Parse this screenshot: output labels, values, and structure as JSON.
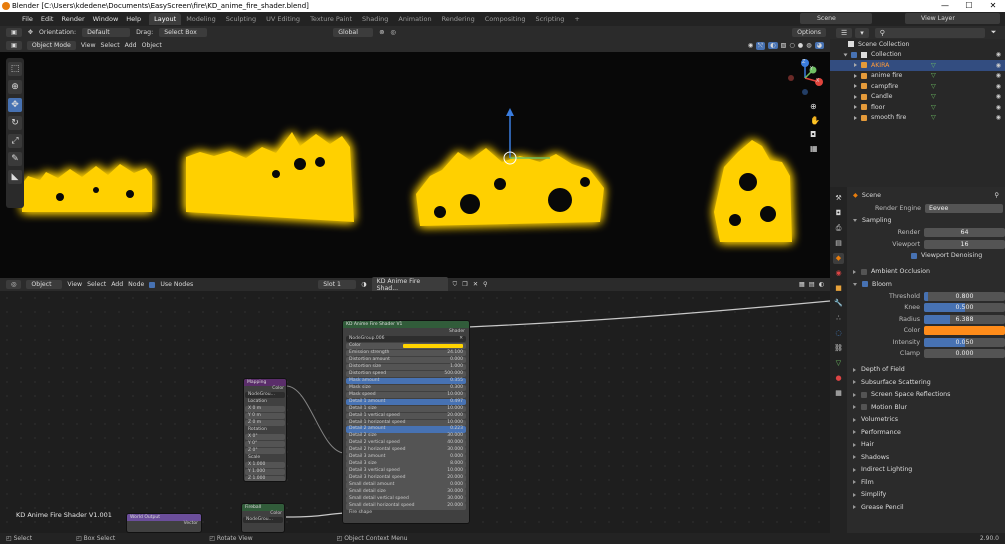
{
  "window": {
    "title": "Blender [C:\\Users\\kdedene\\Documents\\EasyScreen\\fire\\KD_anime_fire_shader.blend]",
    "minimize": "—",
    "maximize": "☐",
    "close": "✕"
  },
  "menu": [
    "File",
    "Edit",
    "Render",
    "Window",
    "Help"
  ],
  "workspaces": [
    "Layout",
    "Modeling",
    "Sculpting",
    "UV Editing",
    "Texture Paint",
    "Shading",
    "Animation",
    "Rendering",
    "Compositing",
    "Scripting"
  ],
  "scene": "Scene",
  "view_layer": "View Layer",
  "tool_header": {
    "orientation_label": "Orientation:",
    "orientation": "Default",
    "drag_label": "Drag:",
    "drag": "Select Box",
    "transform": "Global",
    "options": "Options"
  },
  "viewport_header": {
    "mode": "Object Mode",
    "menus": [
      "View",
      "Select",
      "Add",
      "Object"
    ]
  },
  "gizmo": {
    "x": "X",
    "y": "Y",
    "z": "Z"
  },
  "node_header": {
    "editor_type": "Object",
    "menus": [
      "View",
      "Select",
      "Add",
      "Node"
    ],
    "use_nodes": "Use Nodes",
    "slot": "Slot 1",
    "material": "KD Anime Fire Shad..."
  },
  "node_label": "KD Anime Fire Shader V1.001",
  "nodes": {
    "main_title": "KD Anime Fire Shader V1",
    "main_output": "Shader",
    "group_name": "NodeGroup.006",
    "main_rows": [
      {
        "label": "Emission strength",
        "value": "24.100"
      },
      {
        "label": "Distortion amount",
        "value": "0.000"
      },
      {
        "label": "Distortion size",
        "value": "1.000"
      },
      {
        "label": "Distortion speed",
        "value": "500.000"
      },
      {
        "label": "Mask amount",
        "value": "0.355"
      },
      {
        "label": "Mask size",
        "value": "0.300"
      },
      {
        "label": "Mask speed",
        "value": "10.000"
      },
      {
        "label": "Detail 1 amount",
        "value": "0.497"
      },
      {
        "label": "Detail 1 size",
        "value": "10.000"
      },
      {
        "label": "Detail 1 vertical speed",
        "value": "20.000"
      },
      {
        "label": "Detail 1 horizontal speed",
        "value": "10.000"
      },
      {
        "label": "Detail 2 amount",
        "value": "0.223"
      },
      {
        "label": "Detail 2 size",
        "value": "30.000"
      },
      {
        "label": "Detail 2 vertical speed",
        "value": "40.000"
      },
      {
        "label": "Detail 2 horizontal speed",
        "value": "30.000"
      },
      {
        "label": "Detail 3 amount",
        "value": "0.000"
      },
      {
        "label": "Detail 3 size",
        "value": "8.000"
      },
      {
        "label": "Detail 3 vertical speed",
        "value": "10.000"
      },
      {
        "label": "Detail 3 horizontal speed",
        "value": "20.000"
      },
      {
        "label": "Small detail amount",
        "value": "0.000"
      },
      {
        "label": "Small detail size",
        "value": "30.000"
      },
      {
        "label": "Small detail vertical speed",
        "value": "30.000"
      },
      {
        "label": "Small detail horizontal speed",
        "value": "20.000"
      },
      {
        "label": "Fire shape",
        "value": ""
      }
    ],
    "color_label": "Color",
    "mapping_title": "Mapping",
    "mapping_group": "NodeGrou...",
    "mapping_rows": [
      "Location",
      "X  0 m",
      "Y  0 m",
      "Z  0 m",
      "Rotation",
      "X  0°",
      "Y  0°",
      "Z  0°",
      "Scale",
      "X  1.000",
      "Y  1.000",
      "Z  1.000"
    ],
    "mapping_output": "Color",
    "bottom_title": "Fireball",
    "bottom_output": "Color",
    "bottom_group": "NodeGrou...",
    "world_title": "World Output",
    "world_row": "Vector"
  },
  "outliner": {
    "root": "Scene Collection",
    "collection": "Collection",
    "items": [
      "AKIRA",
      "anime fire",
      "campfire",
      "Candle",
      "floor",
      "smooth fire"
    ]
  },
  "properties": {
    "context": "Scene",
    "render_engine_label": "Render Engine",
    "render_engine": "Eevee",
    "sampling": "Sampling",
    "render_label": "Render",
    "render_value": "64",
    "viewport_label": "Viewport",
    "viewport_value": "16",
    "viewport_denoising": "Viewport Denoising",
    "ambient_occlusion": "Ambient Occlusion",
    "bloom": "Bloom",
    "threshold_label": "Threshold",
    "threshold": "0.800",
    "threshold_fill": 0.05,
    "knee_label": "Knee",
    "knee": "0.500",
    "knee_fill": 0.5,
    "radius_label": "Radius",
    "radius": "6.388",
    "radius_fill": 0.32,
    "color_label": "Color",
    "bloom_color": "#ff8c1a",
    "intensity_label": "Intensity",
    "intensity": "0.050",
    "intensity_fill": 0.5,
    "clamp_label": "Clamp",
    "clamp": "0.000",
    "sections": [
      "Depth of Field",
      "Subsurface Scattering",
      "Screen Space Reflections",
      "Motion Blur",
      "Volumetrics",
      "Performance",
      "Hair",
      "Shadows",
      "Indirect Lighting",
      "Film",
      "Simplify",
      "Grease Pencil"
    ]
  },
  "statusbar": {
    "select": "Select",
    "box_select": "Box Select",
    "rotate_view": "Rotate View",
    "context_menu": "Object Context Menu",
    "version": "2.90.0"
  },
  "colors": {
    "accent": "#4772b3",
    "fire": "#ffd400",
    "glow": "#ff8a00"
  }
}
